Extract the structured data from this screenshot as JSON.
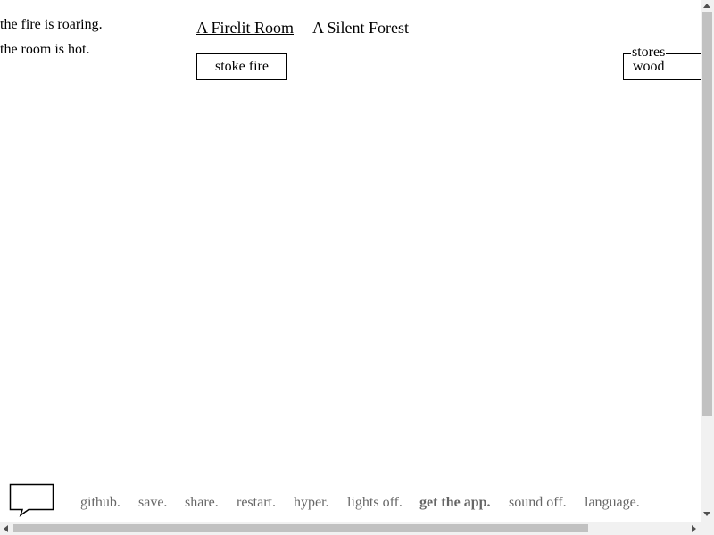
{
  "notifications": [
    "the fire is roaring.",
    "the room is hot."
  ],
  "header": {
    "tabs": [
      {
        "label": "A Firelit Room",
        "selected": true
      },
      {
        "label": "A Silent Forest",
        "selected": false
      }
    ]
  },
  "actions": {
    "stoke_fire": "stoke fire"
  },
  "stores": {
    "legend": "stores",
    "items": [
      {
        "name": "wood",
        "value": ""
      }
    ]
  },
  "footer": {
    "chat_icon": "speech-bubble-icon",
    "links": [
      {
        "label": "github.",
        "bold": false
      },
      {
        "label": "save.",
        "bold": false
      },
      {
        "label": "share.",
        "bold": false
      },
      {
        "label": "restart.",
        "bold": false
      },
      {
        "label": "hyper.",
        "bold": false
      },
      {
        "label": "lights off.",
        "bold": false
      },
      {
        "label": "get the app.",
        "bold": true
      },
      {
        "label": "sound off.",
        "bold": false
      },
      {
        "label": "language.",
        "bold": false
      }
    ]
  },
  "colors": {
    "text": "#000000",
    "footer_link": "#666666",
    "scrollbar_thumb": "#c1c1c1",
    "scrollbar_track": "#f1f1f1"
  }
}
